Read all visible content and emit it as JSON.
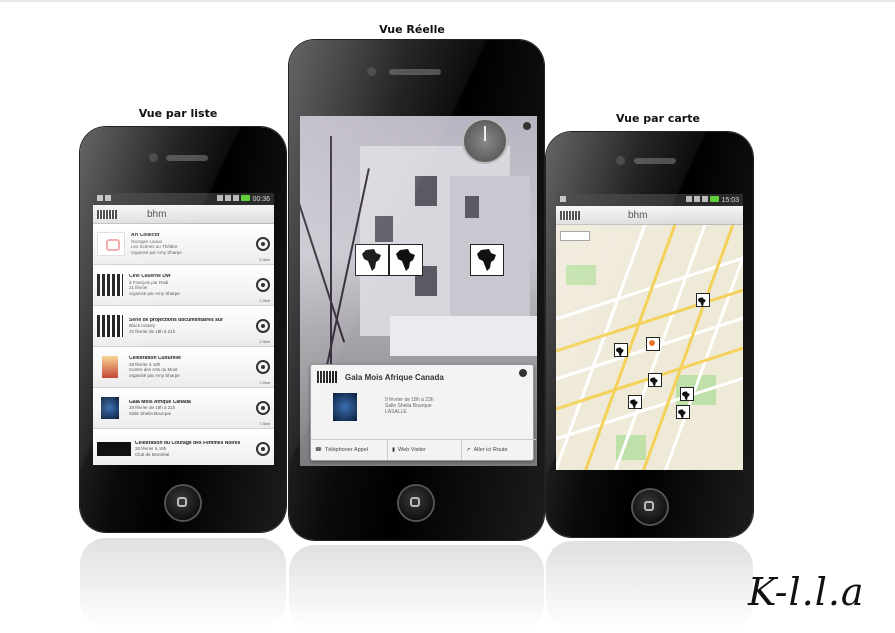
{
  "captions": {
    "list": "Vue par liste",
    "ar": "Vue Réelle",
    "map": "Vue par carte"
  },
  "status": {
    "time_list": "00:36",
    "time_map": "15:03"
  },
  "app": {
    "title": "bhm"
  },
  "list_items": [
    {
      "title": "Art Collectif",
      "sub": "Georges Laoun",
      "line2": "Les Scènes au Théâtre",
      "footer": "organisé par Amy Sharpe",
      "dist": "2.0km"
    },
    {
      "title": "Ciné Caserne DW",
      "sub": "à Français par Radi",
      "line2": "21 février",
      "footer": "organisé par Amy Sharpe",
      "dist": "1.2km"
    },
    {
      "title": "Série de projections documentaires sur",
      "sub": "Black History",
      "line2": "20 février de 18h à 21h",
      "footer": "",
      "dist": "1.3km"
    },
    {
      "title": "Célébration Culturelle",
      "sub": "28 février à 18h",
      "line2": "Centre des Arts du Mont",
      "footer": "organisé par Amy Sharpe",
      "dist": "7.2km"
    },
    {
      "title": "Gala Mois Afrique Canada",
      "sub": "28 février de 18h à 21h",
      "line2": "Salle Sheila Bourque",
      "footer": "",
      "dist": "7.3km"
    },
    {
      "title": "Célébration du Courage des Femmes Noires",
      "sub": "28 février à 18h",
      "line2": "Club de Montréal",
      "footer": "",
      "dist": ""
    }
  ],
  "ar": {
    "popup_title": "Gala Mois Afrique Canada",
    "popup_line1": "9 février de 18h à 23h",
    "popup_line2": "Salle Sheila Bourque",
    "popup_line3": "LASALLE",
    "btn_phone": "Téléphoner Appel",
    "btn_web": "Web Visiter",
    "btn_route": "Aller ici Route"
  },
  "logo_text": "K-l.l.a",
  "colors": {
    "battery": "#5fcf3a",
    "map_bg": "#efe9d8",
    "park": "#bfe0a8",
    "road_major": "#f4d25a"
  }
}
